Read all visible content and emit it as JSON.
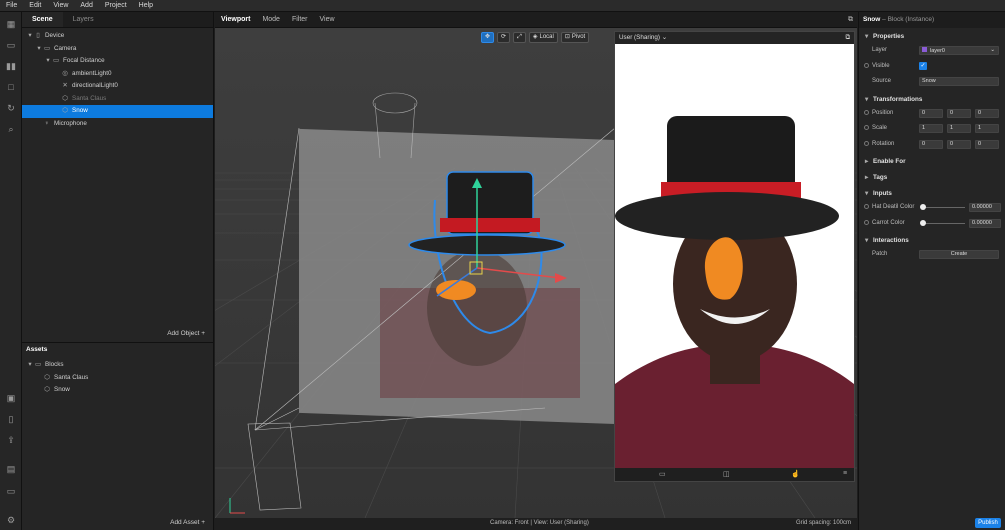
{
  "menu": [
    "File",
    "Edit",
    "View",
    "Add",
    "Project",
    "Help"
  ],
  "scene_panel": {
    "tabs": [
      "Scene",
      "Layers"
    ],
    "tree": [
      {
        "label": "Device",
        "icon": "device-icon",
        "indent": 0,
        "arrow": "▾"
      },
      {
        "label": "Camera",
        "icon": "camera-icon",
        "indent": 1,
        "arrow": "▾"
      },
      {
        "label": "Focal Distance",
        "icon": "focal-distance-icon",
        "indent": 2,
        "arrow": "▾"
      },
      {
        "label": "ambientLight0",
        "icon": "ambient-light-icon",
        "indent": 3,
        "arrow": ""
      },
      {
        "label": "directionalLight0",
        "icon": "directional-light-icon",
        "indent": 3,
        "arrow": ""
      },
      {
        "label": "Santa Claus",
        "icon": "block-icon",
        "indent": 3,
        "arrow": "",
        "dim": true
      },
      {
        "label": "Snow",
        "icon": "block-icon",
        "indent": 3,
        "arrow": "",
        "selected": true
      },
      {
        "label": "Microphone",
        "icon": "microphone-icon",
        "indent": 1,
        "arrow": ""
      }
    ],
    "add_label": "Add Object"
  },
  "assets_panel": {
    "title": "Assets",
    "tree": [
      {
        "label": "Blocks",
        "icon": "folder-icon",
        "indent": 0,
        "arrow": "▾"
      },
      {
        "label": "Santa Claus",
        "icon": "block-icon",
        "indent": 1,
        "arrow": ""
      },
      {
        "label": "Snow",
        "icon": "block-icon",
        "indent": 1,
        "arrow": ""
      }
    ],
    "add_label": "Add Asset"
  },
  "viewport": {
    "tabs": [
      "Viewport",
      "Mode",
      "Filter",
      "View"
    ],
    "local_label": "Local",
    "pivot_label": "Pivot",
    "status_camera": "Camera: Front | View: User (Sharing)",
    "status_grid": "Grid spacing: 100cm"
  },
  "preview": {
    "title": "User (Sharing)"
  },
  "properties": {
    "object_name": "Snow",
    "object_type": "Block (Instance)",
    "sections": {
      "properties": "Properties",
      "transformations": "Transformations",
      "enable_for": "Enable For",
      "tags": "Tags",
      "inputs": "Inputs",
      "interactions": "Interactions"
    },
    "layer_label": "Layer",
    "layer_value": "layer0",
    "visible_label": "Visible",
    "source_label": "Source",
    "source_value": "Snow",
    "position_label": "Position",
    "position": [
      "0",
      "0",
      "0"
    ],
    "scale_label": "Scale",
    "scale": [
      "1",
      "1",
      "1"
    ],
    "rotation_label": "Rotation",
    "rotation": [
      "0",
      "0",
      "0"
    ],
    "hat_label": "Hat Deatil Color",
    "hat_value": "0.00000",
    "carrot_label": "Carrot Color",
    "carrot_value": "0.00000",
    "patch_label": "Patch",
    "create_label": "Create",
    "publish_label": "Publish"
  },
  "colors": {
    "accent": "#0d7bdf",
    "layer_swatch": "#8a5cd6"
  }
}
